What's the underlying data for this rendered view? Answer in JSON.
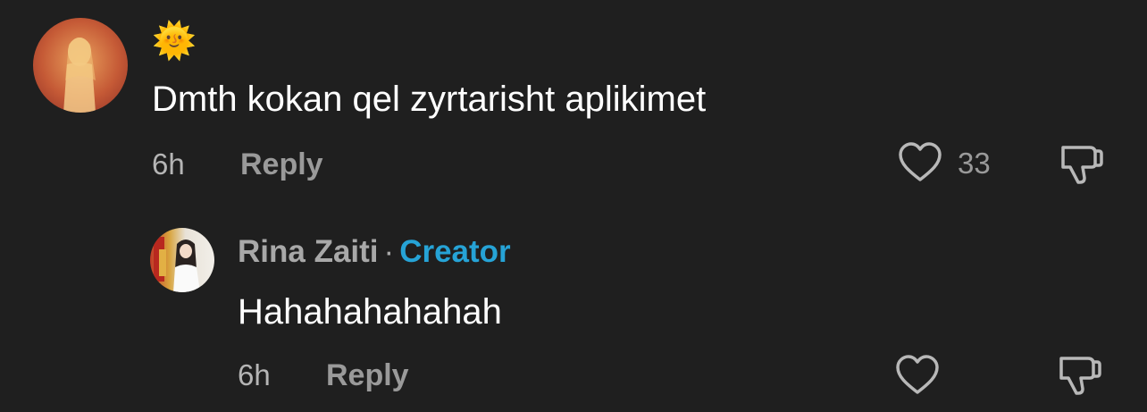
{
  "comments": [
    {
      "username": "🌞",
      "text": "Dmth kokan qel zyrtarisht aplikimet",
      "time": "6h",
      "reply_label": "Reply",
      "like_count": "33"
    }
  ],
  "reply": {
    "username": "Rina Zaiti",
    "separator": "·",
    "badge": "Creator",
    "text": "Hahahahahahah",
    "time": "6h",
    "reply_label": "Reply"
  },
  "colors": {
    "background": "#1f1f1f",
    "primary_text": "#ffffff",
    "secondary_text": "#9a9a9a",
    "creator_badge": "#26a3d6"
  },
  "icons": {
    "like": "heart-outline-icon",
    "dislike": "thumbs-down-outline-icon"
  }
}
